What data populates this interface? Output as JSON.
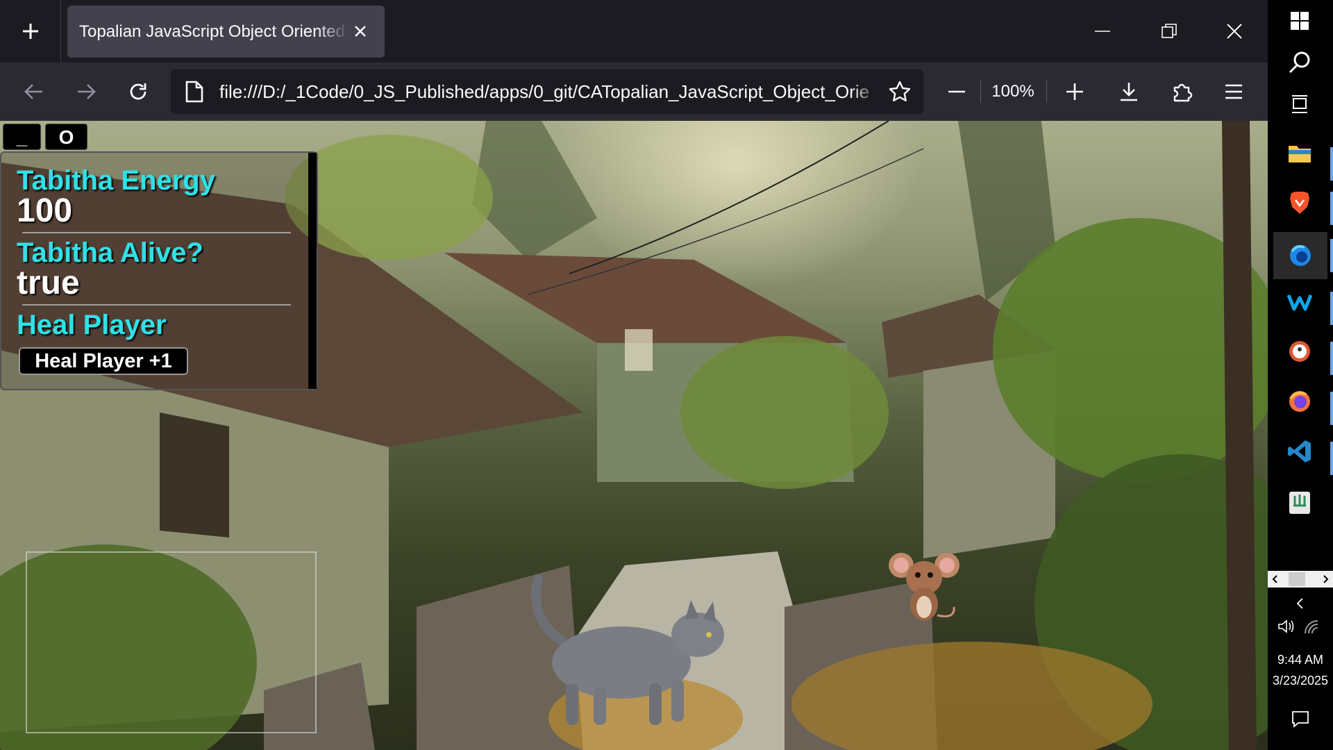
{
  "browser": {
    "tab_title": "Topalian JavaScript Object Oriented G",
    "url": "file:///D:/_1Code/0_JS_Published/apps/0_git/CATopalian_JavaScript_Object_Orie",
    "zoom": "100%",
    "icons": [
      "new-tab-icon",
      "close-icon",
      "minimize-icon",
      "restore-icon",
      "back-icon",
      "forward-icon",
      "reload-icon",
      "page-icon",
      "star-icon",
      "zoom-out-icon",
      "zoom-in-icon",
      "download-icon",
      "extensions-icon",
      "menu-icon"
    ]
  },
  "game": {
    "controls": {
      "minimize": "_",
      "open": "O"
    },
    "stats": {
      "energy_label": "Tabitha Energy",
      "energy_value": "100",
      "alive_label": "Tabitha Alive?",
      "alive_value": "true",
      "heal_label": "Heal Player",
      "heal_button": "Heal Player +1"
    },
    "sprites": [
      "cat",
      "mouse"
    ]
  },
  "taskbar": {
    "apps": [
      "windows-start",
      "search",
      "task-view",
      "file-explorer",
      "brave",
      "firefox-dev",
      "windsurf",
      "duckduckgo",
      "firefox",
      "vscode",
      "app"
    ],
    "time": "9:44 AM",
    "date": "3/23/2025"
  },
  "colors": {
    "stat_label": "#2fe1e8",
    "tab_bg": "#42414d",
    "toolbar_bg": "#2b2a33"
  }
}
